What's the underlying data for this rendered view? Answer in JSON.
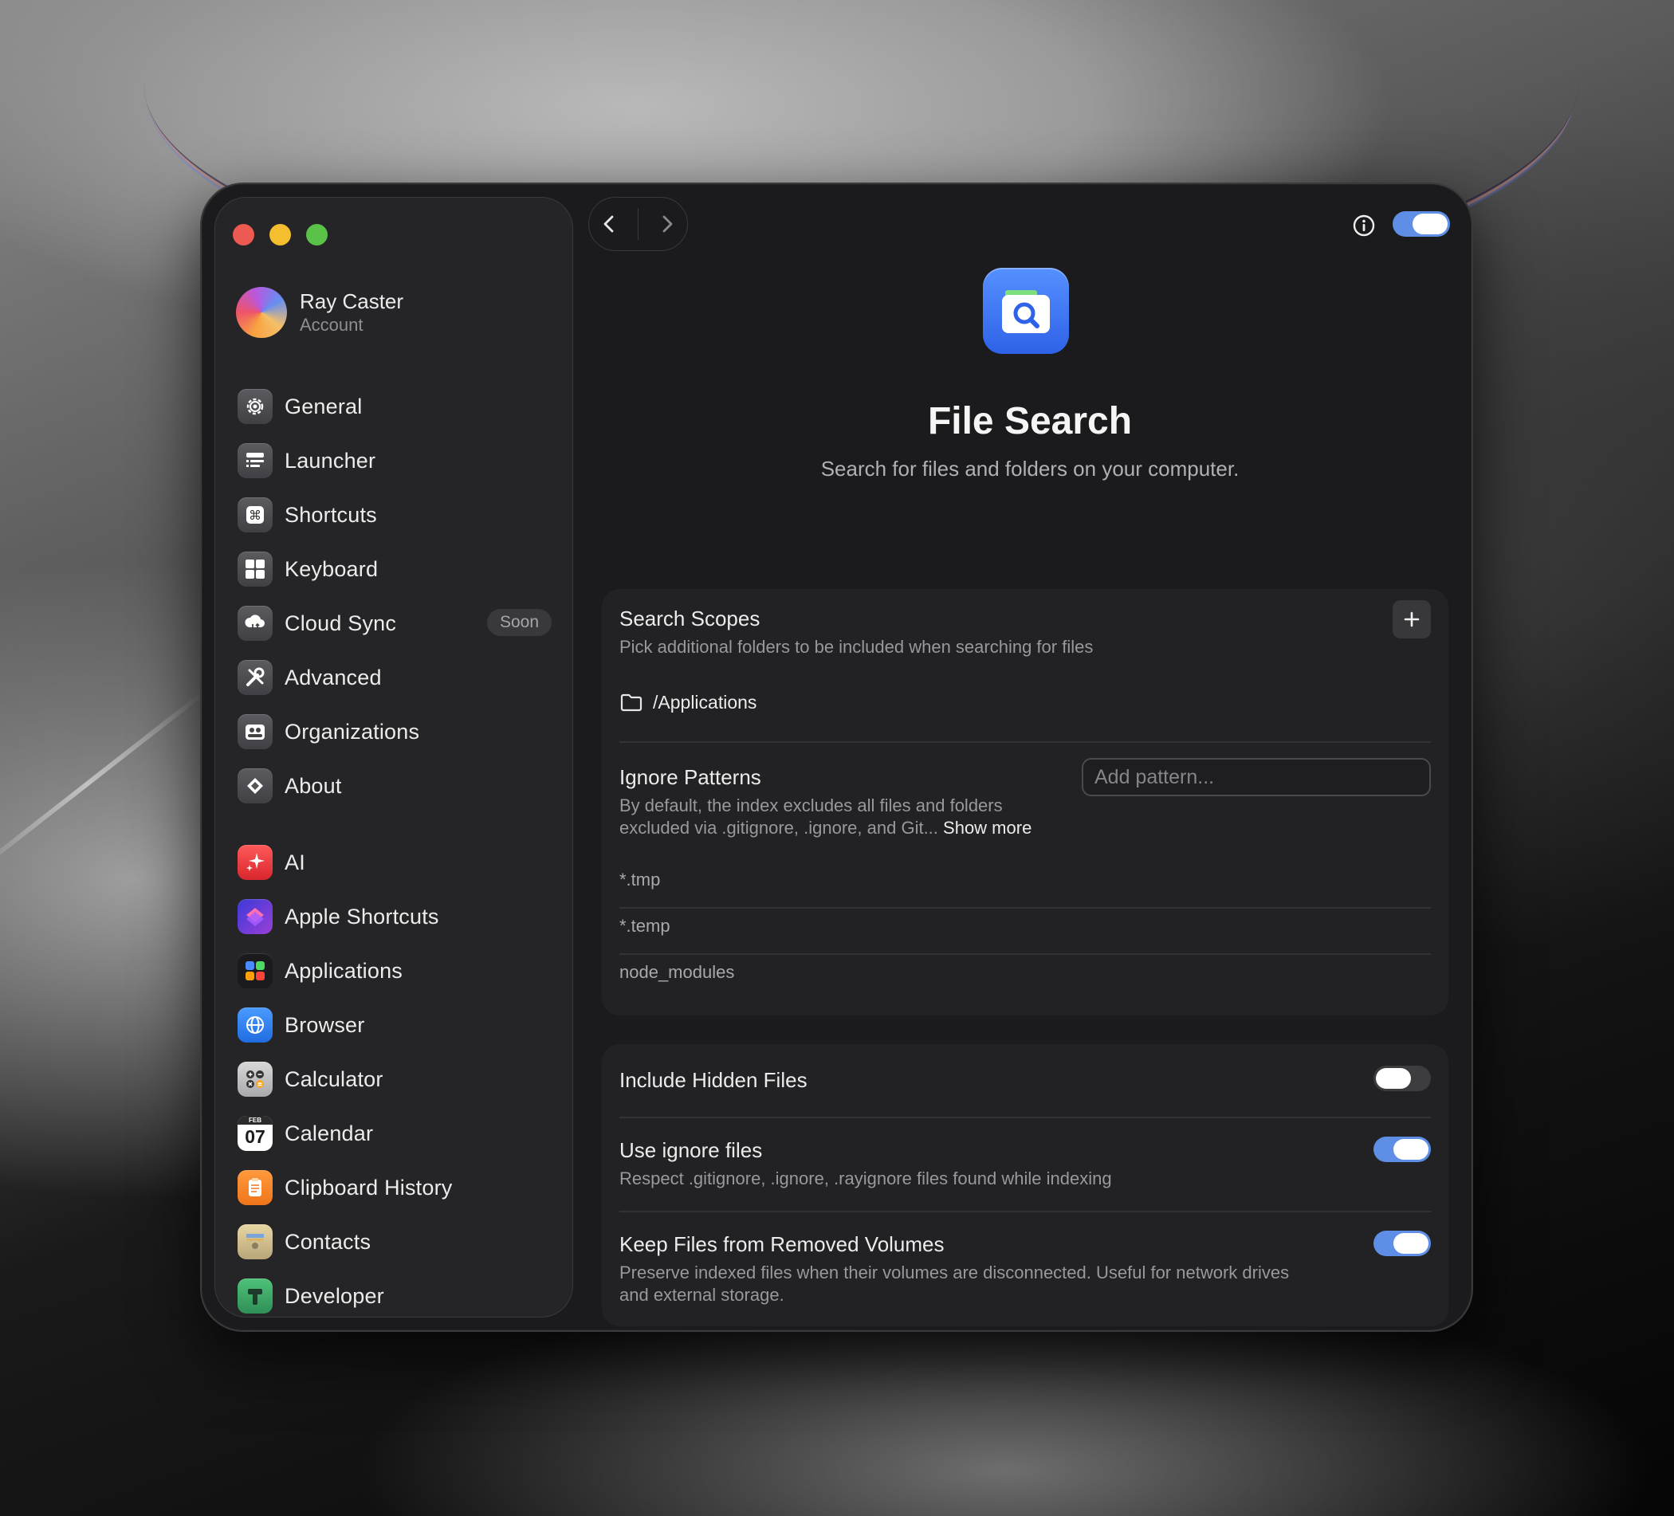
{
  "account": {
    "name": "Ray Caster",
    "subtitle": "Account"
  },
  "sidebar": {
    "settings_items": [
      {
        "label": "General",
        "icon": "gear-icon"
      },
      {
        "label": "Launcher",
        "icon": "launcher-icon"
      },
      {
        "label": "Shortcuts",
        "icon": "command-key-icon"
      },
      {
        "label": "Keyboard",
        "icon": "keyboard-icon"
      },
      {
        "label": "Cloud Sync",
        "icon": "cloud-sync-icon",
        "badge": "Soon"
      },
      {
        "label": "Advanced",
        "icon": "tools-icon"
      },
      {
        "label": "Organizations",
        "icon": "organization-icon"
      },
      {
        "label": "About",
        "icon": "about-icon"
      }
    ],
    "extension_items": [
      {
        "label": "AI",
        "icon": "ai-sparkle-icon"
      },
      {
        "label": "Apple Shortcuts",
        "icon": "apple-shortcuts-icon"
      },
      {
        "label": "Applications",
        "icon": "applications-icon"
      },
      {
        "label": "Browser",
        "icon": "browser-globe-icon"
      },
      {
        "label": "Calculator",
        "icon": "calculator-icon"
      },
      {
        "label": "Calendar",
        "icon": "calendar-icon",
        "month": "FEB",
        "day": "07"
      },
      {
        "label": "Clipboard History",
        "icon": "clipboard-icon"
      },
      {
        "label": "Contacts",
        "icon": "contacts-icon"
      },
      {
        "label": "Developer",
        "icon": "developer-icon"
      }
    ]
  },
  "header": {
    "enabled": true
  },
  "hero": {
    "title": "File Search",
    "subtitle": "Search for files and folders on your computer."
  },
  "search_scopes": {
    "title": "Search Scopes",
    "description": "Pick additional folders to be included when searching for files",
    "folders": [
      "/Applications"
    ]
  },
  "ignore_patterns": {
    "title": "Ignore Patterns",
    "description_line1": "By default, the index excludes all files and folders",
    "description_line2": "excluded via .gitignore, .ignore, and Git...",
    "show_more": "Show more",
    "input_placeholder": "Add pattern...",
    "patterns": [
      "*.tmp",
      "*.temp",
      "node_modules"
    ]
  },
  "options": [
    {
      "title": "Include Hidden Files",
      "description": "",
      "enabled": false
    },
    {
      "title": "Use ignore files",
      "description": "Respect .gitignore, .ignore, .rayignore files found while indexing",
      "enabled": true
    },
    {
      "title": "Keep Files from Removed Volumes",
      "description_line1": "Preserve indexed files when their volumes are disconnected. Useful for network drives",
      "description_line2": "and external storage.",
      "enabled": true
    }
  ],
  "colors": {
    "accent": "#5e8ee6",
    "window_bg": "#1b1b1d",
    "sidebar_bg": "#252527"
  }
}
